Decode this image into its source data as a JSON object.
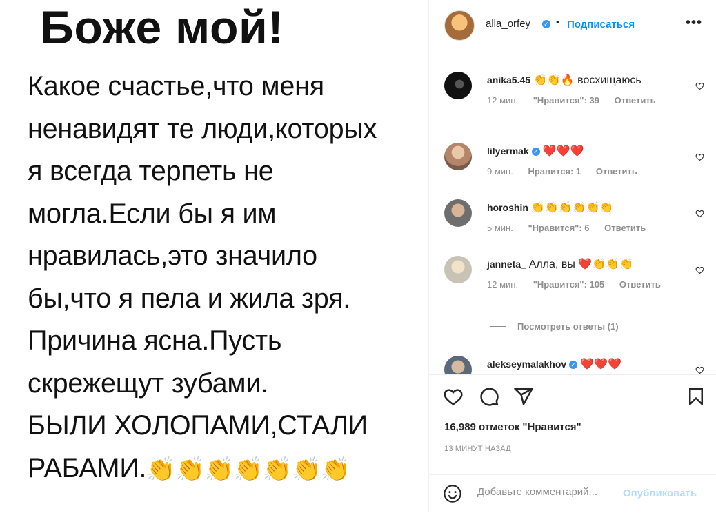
{
  "post": {
    "heading": "Боже мой!",
    "body_lines": [
      "Какое счастье,что меня",
      "ненавидят те люди,которых",
      "я всегда терпеть не",
      "могла.Если бы я им",
      "нравилась,это значило",
      "бы,что я пела и жила зря.",
      "Причина ясна.Пусть",
      "скрежещут зубами.",
      "БЫЛИ ХОЛОПАМИ,СТАЛИ",
      "РАБАМИ."
    ],
    "clap_emojis": "👏👏👏👏👏👏👏"
  },
  "header": {
    "username": "alla_orfey",
    "separator": "•",
    "follow_label": "Подписаться",
    "more_label": "•••"
  },
  "comments": [
    {
      "username": "anika5.45",
      "verified": false,
      "text": "👏👏🔥 восхищаюсь",
      "time": "12 мин.",
      "likes": "\"Нравится\": 39",
      "reply": "Ответить"
    },
    {
      "username": "lilyermak",
      "verified": true,
      "text": "❤️❤️❤️",
      "time": "9 мин.",
      "likes": "Нравится: 1",
      "reply": "Ответить"
    },
    {
      "username": "horoshin",
      "verified": false,
      "text": "👏👏👏👏👏👏",
      "time": "5 мин.",
      "likes": "\"Нравится\": 6",
      "reply": "Ответить"
    },
    {
      "username": "janneta_",
      "verified": false,
      "text": "Алла, вы ❤️👏👏👏",
      "time": "12 мин.",
      "likes": "\"Нравится\": 105",
      "reply": "Ответить"
    },
    {
      "username": "alekseymalakhov",
      "verified": true,
      "text": "❤️❤️❤️",
      "time": "",
      "likes": "",
      "reply": ""
    }
  ],
  "view_replies": "Посмотреть ответы (1)",
  "actions": {
    "likes_count": "16,989 отметок \"Нравится\"",
    "timestamp": "13 МИНУТ НАЗАД"
  },
  "add_comment": {
    "placeholder": "Добавьте комментарий...",
    "publish_label": "Опубликовать"
  },
  "icons": {
    "header_more": "more-icon",
    "like": "heart-icon",
    "comment": "comment-icon",
    "share": "send-icon",
    "save": "bookmark-icon",
    "emoji": "emoji-icon"
  },
  "colors": {
    "link_blue": "#0095f6",
    "publish_disabled": "#b2dffc",
    "verified_blue": "#3897f0",
    "muted_text": "#8e8e8e",
    "border": "#efefef"
  }
}
